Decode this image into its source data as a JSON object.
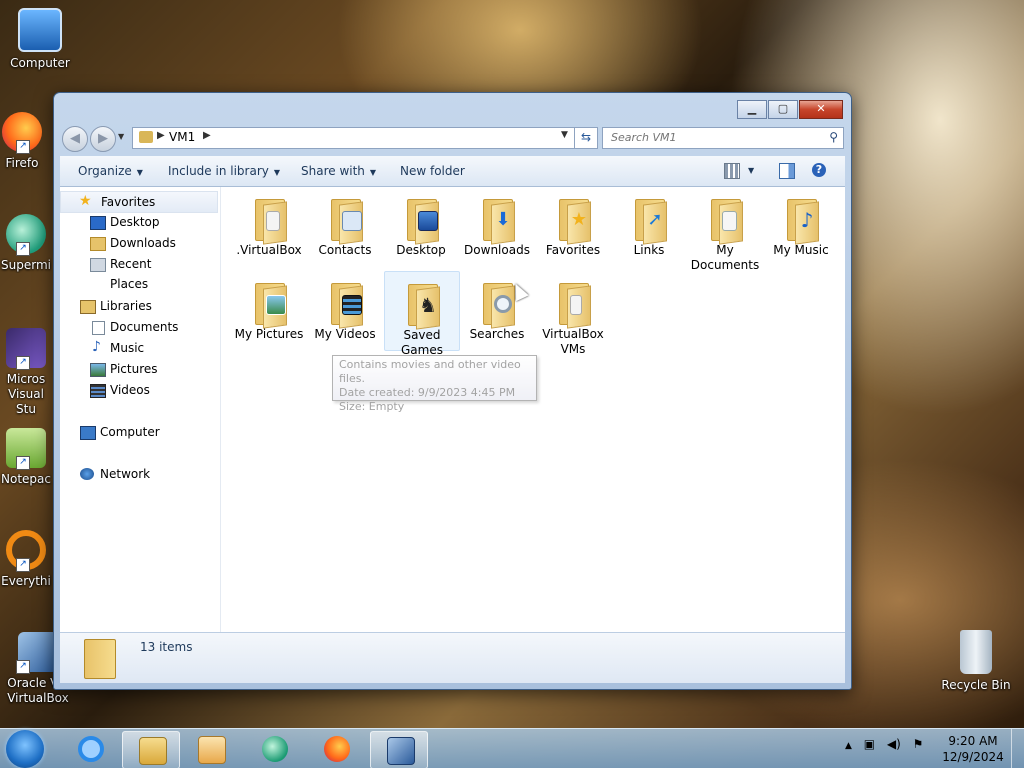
{
  "desktop": {
    "icons": [
      {
        "label": "Computer"
      },
      {
        "label": "Firefo"
      },
      {
        "label": "Supermi"
      },
      {
        "label": "Micros Visual Stu"
      },
      {
        "label": "Notepac"
      },
      {
        "label": "Everythi"
      },
      {
        "label": "Oracle VM VirtualBox"
      },
      {
        "label": "Recycle Bin"
      }
    ]
  },
  "window": {
    "address": {
      "crumb": "VM1"
    },
    "search": {
      "placeholder": "Search VM1"
    },
    "toolbar": {
      "organize": "Organize",
      "include": "Include in library",
      "share": "Share with",
      "new_folder": "New folder"
    },
    "nav": {
      "favorites": "Favorites",
      "desktop": "Desktop",
      "downloads": "Downloads",
      "recent": "Recent Places",
      "libraries": "Libraries",
      "documents": "Documents",
      "music": "Music",
      "pictures": "Pictures",
      "videos": "Videos",
      "computer": "Computer",
      "network": "Network"
    },
    "files": [
      {
        "name": ".VirtualBox",
        "emblem": "doc"
      },
      {
        "name": "Contacts",
        "emblem": "contact"
      },
      {
        "name": "Desktop",
        "emblem": "monitor"
      },
      {
        "name": "Downloads",
        "emblem": "download-arrow"
      },
      {
        "name": "Favorites",
        "emblem": "star"
      },
      {
        "name": "Links",
        "emblem": "link-arrow"
      },
      {
        "name": "My Documents",
        "emblem": "doc"
      },
      {
        "name": "My Music",
        "emblem": "note"
      },
      {
        "name": "My Pictures",
        "emblem": "photo"
      },
      {
        "name": "My Videos",
        "emblem": "film"
      },
      {
        "name": "Saved Games",
        "emblem": "chess"
      },
      {
        "name": "Searches",
        "emblem": "magnifier"
      },
      {
        "name": "VirtualBox VMs",
        "emblem": "doc"
      }
    ],
    "tooltip": {
      "line1": "Contains movies and other video files.",
      "line2": "Date created: 9/9/2023 4:45 PM",
      "line3": "Size: Empty"
    },
    "status": {
      "count": "13 items"
    }
  },
  "taskbar": {
    "time": "9:20 AM",
    "date": "12/9/2024"
  }
}
